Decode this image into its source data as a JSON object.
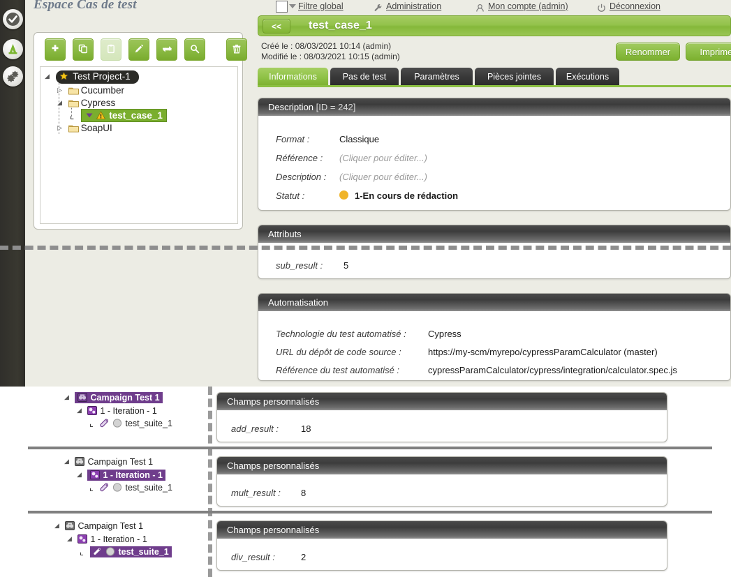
{
  "rail": {
    "items": [
      {
        "name": "test-cases",
        "icon": "check-circle-icon"
      },
      {
        "name": "campaigns",
        "icon": "campaign-icon"
      },
      {
        "name": "administration",
        "icon": "gears-icon"
      }
    ]
  },
  "left": {
    "space_title": "Espace Cas de test",
    "toolbar": [
      {
        "key": "add",
        "icon": "plus-icon",
        "title": "Ajouter"
      },
      {
        "key": "copy",
        "icon": "copy-icon",
        "title": "Copier"
      },
      {
        "key": "paste",
        "icon": "paste-icon",
        "title": "Coller"
      },
      {
        "key": "edit",
        "icon": "pencil-icon",
        "title": "Renommer"
      },
      {
        "key": "move",
        "icon": "move-arrows-icon",
        "title": "Déplacer"
      },
      {
        "key": "search",
        "icon": "magnifier-icon",
        "title": "Rechercher"
      },
      {
        "key": "delete",
        "icon": "trash-icon",
        "title": "Supprimer"
      }
    ],
    "tree": {
      "root": "Test Project-1",
      "children": [
        "Cucumber",
        "Cypress",
        "SoapUI"
      ],
      "selected": "test_case_1"
    }
  },
  "topnav": {
    "filtre_global": "Filtre global",
    "administration": "Administration",
    "mon_compte": "Mon compte (admin)",
    "deconnexion": "Déconnexion"
  },
  "header": {
    "back_label": "<<",
    "title": "test_case_1",
    "created_label": "Créé le :",
    "created_value": "08/03/2021 10:14 (admin)",
    "modified_label": "Modifié le :",
    "modified_value": "08/03/2021 10:15 (admin)",
    "rename_label": "Renommer",
    "print_label": "Imprimer"
  },
  "tabs": [
    {
      "label": "Informations",
      "active": true
    },
    {
      "label": "Pas de test",
      "active": false
    },
    {
      "label": "Paramètres",
      "active": false
    },
    {
      "label": "Pièces jointes",
      "active": false
    },
    {
      "label": "Exécutions",
      "active": false
    }
  ],
  "description_panel": {
    "title": "Description",
    "id_suffix": "[ID = 242]",
    "rows": [
      {
        "label": "Format :",
        "value": "Classique",
        "placeholder": false
      },
      {
        "label": "Référence :",
        "value": "(Cliquer pour éditer...)",
        "placeholder": true
      },
      {
        "label": "Description :",
        "value": "(Cliquer pour éditer...)",
        "placeholder": true
      }
    ],
    "status_label": "Statut :",
    "status_value": "1-En cours de rédaction",
    "status_color": "#f0b429"
  },
  "attributes_panel": {
    "title": "Attributs",
    "rows": [
      {
        "label": "sub_result :",
        "value": "5"
      }
    ]
  },
  "automation_panel": {
    "title": "Automatisation",
    "rows": [
      {
        "label": "Technologie du test automatisé  :",
        "value": "Cypress"
      },
      {
        "label": "URL du dépôt de code source :",
        "value": "https://my-scm/myrepo/cypressParamCalculator (master)"
      },
      {
        "label": "Référence du test automatisé :",
        "value": "cypressParamCalculator/cypress/integration/calculator.spec.js"
      }
    ]
  },
  "bottom_groups": [
    {
      "tree": {
        "campaign": "Campaign Test 1",
        "iteration": "1 - Iteration - 1",
        "suite": "test_suite_1",
        "highlight": "campaign"
      },
      "panel": {
        "title": "Champs personnalisés",
        "field_label": "add_result :",
        "field_value": "18"
      }
    },
    {
      "tree": {
        "campaign": "Campaign Test 1",
        "iteration": "1 - Iteration - 1",
        "suite": "test_suite_1",
        "highlight": "iteration"
      },
      "panel": {
        "title": "Champs personnalisés",
        "field_label": "mult_result :",
        "field_value": "8"
      }
    },
    {
      "tree": {
        "campaign": "Campaign Test 1",
        "iteration": "1 - Iteration - 1",
        "suite": "test_suite_1",
        "highlight": "suite"
      },
      "panel": {
        "title": "Champs personnalisés",
        "field_label": "div_result :",
        "field_value": "2"
      }
    }
  ],
  "colors": {
    "accent_green": "#8cc043",
    "dark_panel": "#3c3c3c",
    "sidebar_dark": "#302f2b",
    "purple": "#6f3d8c",
    "page_bg": "#ecece4",
    "status_amber": "#f0b429"
  }
}
